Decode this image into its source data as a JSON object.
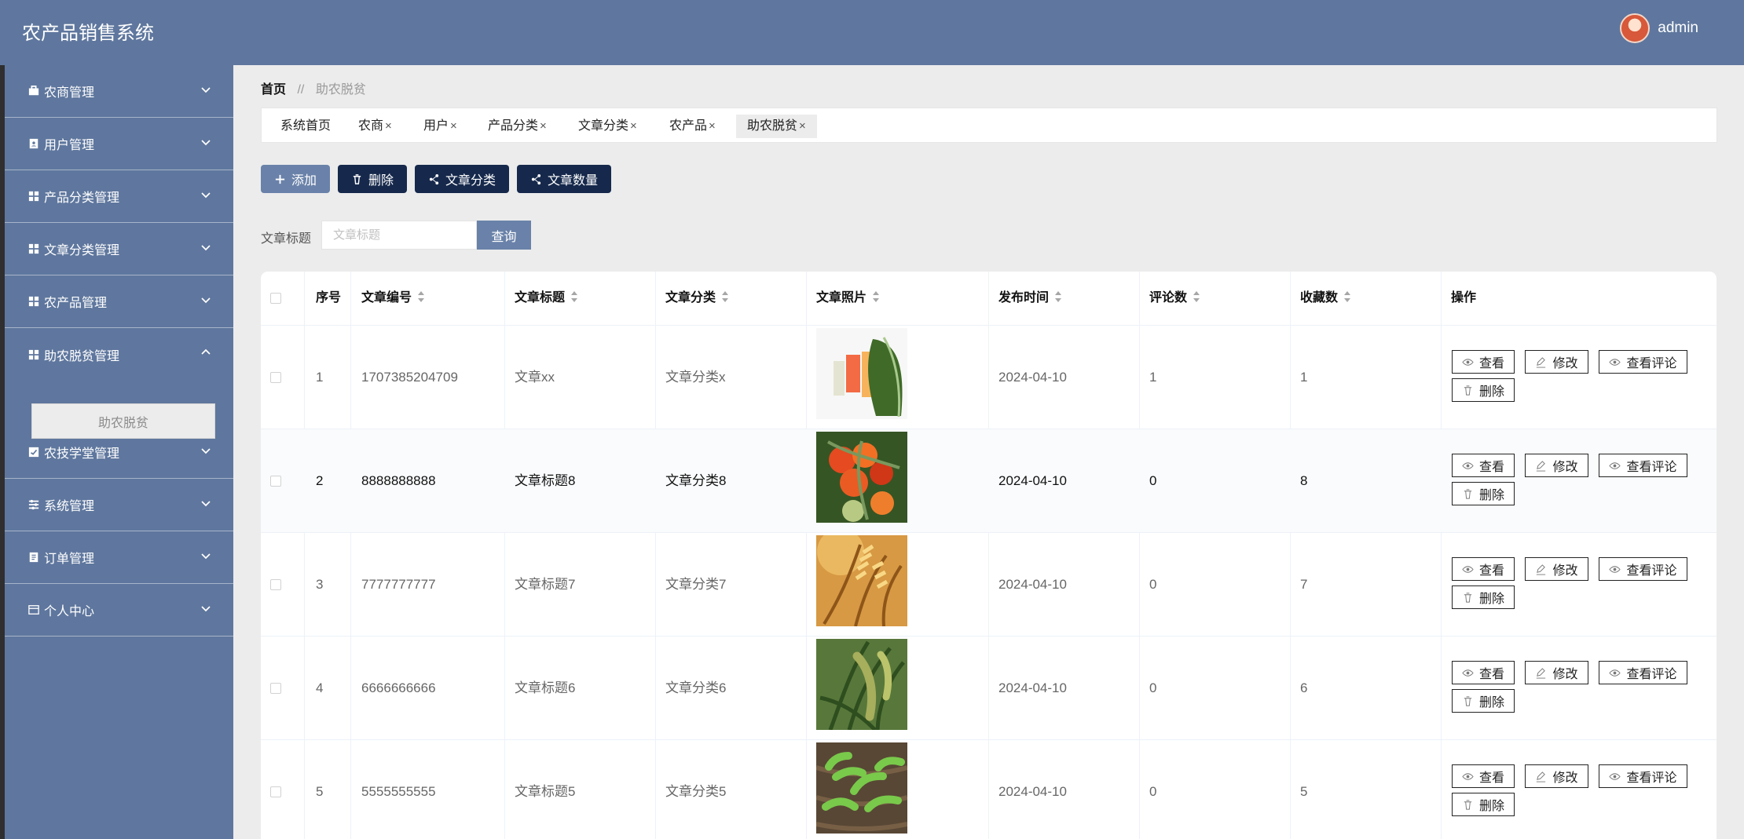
{
  "header": {
    "title": "农产品销售系统",
    "user_name": "admin"
  },
  "sidebar": {
    "items": [
      {
        "label": "农商管理",
        "icon": "briefcase-icon"
      },
      {
        "label": "用户管理",
        "icon": "clipboard-user-icon"
      },
      {
        "label": "产品分类管理",
        "icon": "grid-icon"
      },
      {
        "label": "文章分类管理",
        "icon": "grid-icon"
      },
      {
        "label": "农产品管理",
        "icon": "grid-icon"
      },
      {
        "label": "助农脱贫管理",
        "icon": "grid-icon"
      },
      {
        "label": "农技学堂管理",
        "icon": "checked-box-icon"
      },
      {
        "label": "系统管理",
        "icon": "sliders-icon"
      },
      {
        "label": "订单管理",
        "icon": "document-list-icon"
      },
      {
        "label": "个人中心",
        "icon": "card-icon"
      }
    ],
    "submenu": {
      "label": "助农脱贫"
    }
  },
  "breadcrumb": {
    "home": "首页",
    "separator": "//",
    "current": "助农脱贫"
  },
  "tabs": [
    {
      "label": "系统首页",
      "closable": false
    },
    {
      "label": "农商",
      "closable": true
    },
    {
      "label": "用户",
      "closable": true
    },
    {
      "label": "产品分类",
      "closable": true
    },
    {
      "label": "文章分类",
      "closable": true
    },
    {
      "label": "农产品",
      "closable": true
    },
    {
      "label": "助农脱贫",
      "closable": true,
      "active": true
    }
  ],
  "toolbar": {
    "add_label": "添加",
    "delete_label": "删除",
    "article_category_label": "文章分类",
    "article_count_label": "文章数量"
  },
  "search": {
    "label": "文章标题",
    "placeholder": "文章标题",
    "button_label": "查询"
  },
  "table": {
    "columns": [
      "序号",
      "文章编号",
      "文章标题",
      "文章分类",
      "文章照片",
      "发布时间",
      "评论数",
      "收藏数",
      "操作"
    ],
    "rows": [
      {
        "index": "1",
        "code": "1707385204709",
        "title": "文章xx",
        "category": "文章分类x",
        "photo": "vegetables-image",
        "date": "2024-04-10",
        "comments": "1",
        "favorites": "1"
      },
      {
        "index": "2",
        "code": "8888888888",
        "title": "文章标题8",
        "category": "文章分类8",
        "photo": "tomatoes-image",
        "date": "2024-04-10",
        "comments": "0",
        "favorites": "8"
      },
      {
        "index": "3",
        "code": "7777777777",
        "title": "文章标题7",
        "category": "文章分类7",
        "photo": "wheat-image",
        "date": "2024-04-10",
        "comments": "0",
        "favorites": "7"
      },
      {
        "index": "4",
        "code": "6666666666",
        "title": "文章标题6",
        "category": "文章分类6",
        "photo": "millet-image",
        "date": "2024-04-10",
        "comments": "0",
        "favorites": "6"
      },
      {
        "index": "5",
        "code": "5555555555",
        "title": "文章标题5",
        "category": "文章分类5",
        "photo": "seedlings-image",
        "date": "2024-04-10",
        "comments": "0",
        "favorites": "5"
      }
    ],
    "actions": {
      "view": "查看",
      "edit": "修改",
      "view_comments": "查看评论",
      "delete": "删除"
    }
  },
  "colors": {
    "header": "#5f779e",
    "sidebar": "#5f779e",
    "dark_button": "#16294c",
    "light_button": "#6a82a9",
    "background": "#ececec"
  }
}
